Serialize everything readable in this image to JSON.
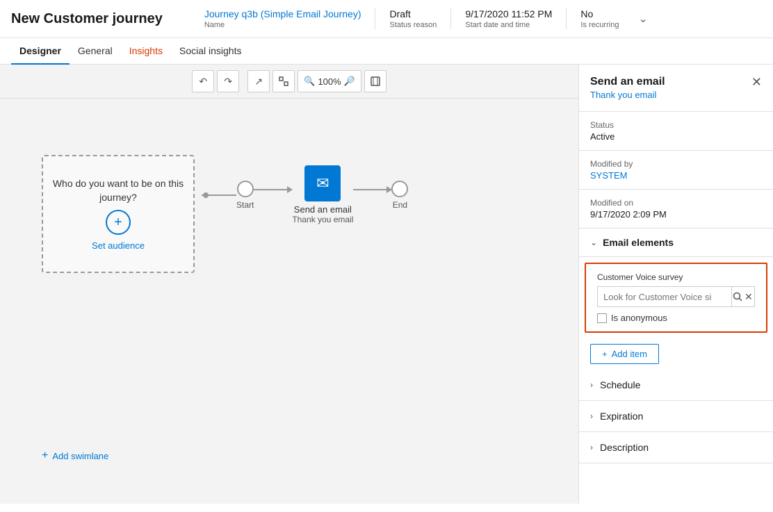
{
  "header": {
    "title": "New Customer journey",
    "journey_name": "Journey q3b (Simple Email Journey)",
    "journey_name_label": "Name",
    "status": "Draft",
    "status_label": "Status reason",
    "start_date": "9/17/2020 11:52 PM",
    "start_date_label": "Start date and time",
    "recurring": "No",
    "recurring_label": "Is recurring"
  },
  "tabs": [
    {
      "id": "designer",
      "label": "Designer",
      "active": true
    },
    {
      "id": "general",
      "label": "General",
      "active": false
    },
    {
      "id": "insights",
      "label": "Insights",
      "active": false
    },
    {
      "id": "social-insights",
      "label": "Social insights",
      "active": false
    }
  ],
  "toolbar": {
    "undo": "↺",
    "redo": "↻",
    "zoom_in_icon": "⤢",
    "fit_icon": "⊡",
    "zoom_out_label": "🔍",
    "zoom_level": "100%",
    "zoom_in_label": "🔍",
    "frame_icon": "⬜"
  },
  "canvas": {
    "audience_text": "Who do you want to be on this journey?",
    "set_audience": "Set audience",
    "add_swimlane": "Add swimlane",
    "nodes": [
      {
        "id": "start",
        "label": "Start"
      },
      {
        "id": "email",
        "label": "Send an email",
        "sublabel": "Thank you email"
      },
      {
        "id": "end",
        "label": "End"
      }
    ]
  },
  "right_panel": {
    "title": "Send an email",
    "subtitle": "Thank you email",
    "close_icon": "✕",
    "status_label": "Status",
    "status_value": "Active",
    "modified_by_label": "Modified by",
    "modified_by_value": "SYSTEM",
    "modified_on_label": "Modified on",
    "modified_on_value": "9/17/2020 2:09 PM",
    "email_elements_title": "Email elements",
    "cv_survey_label": "Customer Voice survey",
    "cv_search_placeholder": "Look for Customer Voice si",
    "cv_anonymous_label": "Is anonymous",
    "add_item_label": "+ Add item",
    "sections": [
      {
        "id": "schedule",
        "label": "Schedule"
      },
      {
        "id": "expiration",
        "label": "Expiration"
      },
      {
        "id": "description",
        "label": "Description"
      }
    ]
  },
  "colors": {
    "accent": "#0078d4",
    "orange": "#d83b01",
    "border_red": "#d83b01",
    "node_blue": "#0078d4",
    "tab_active_border": "#0078d4"
  }
}
